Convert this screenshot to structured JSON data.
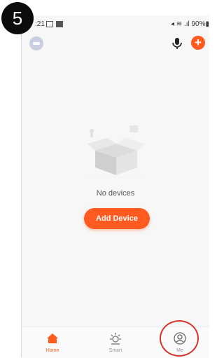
{
  "step": {
    "number": "5"
  },
  "status_bar": {
    "time": ":21",
    "right": "◂ ≋ .ıl 90%▮"
  },
  "home": {
    "empty_text": "No devices",
    "add_device_label": "Add Device"
  },
  "tabs": [
    {
      "label": "Home",
      "icon": "home-icon",
      "active": true
    },
    {
      "label": "Smart",
      "icon": "sun-icon",
      "active": false
    },
    {
      "label": "Me",
      "icon": "person-icon",
      "active": false
    }
  ],
  "colors": {
    "accent": "#ff5a1f",
    "highlight": "#d9342b"
  }
}
